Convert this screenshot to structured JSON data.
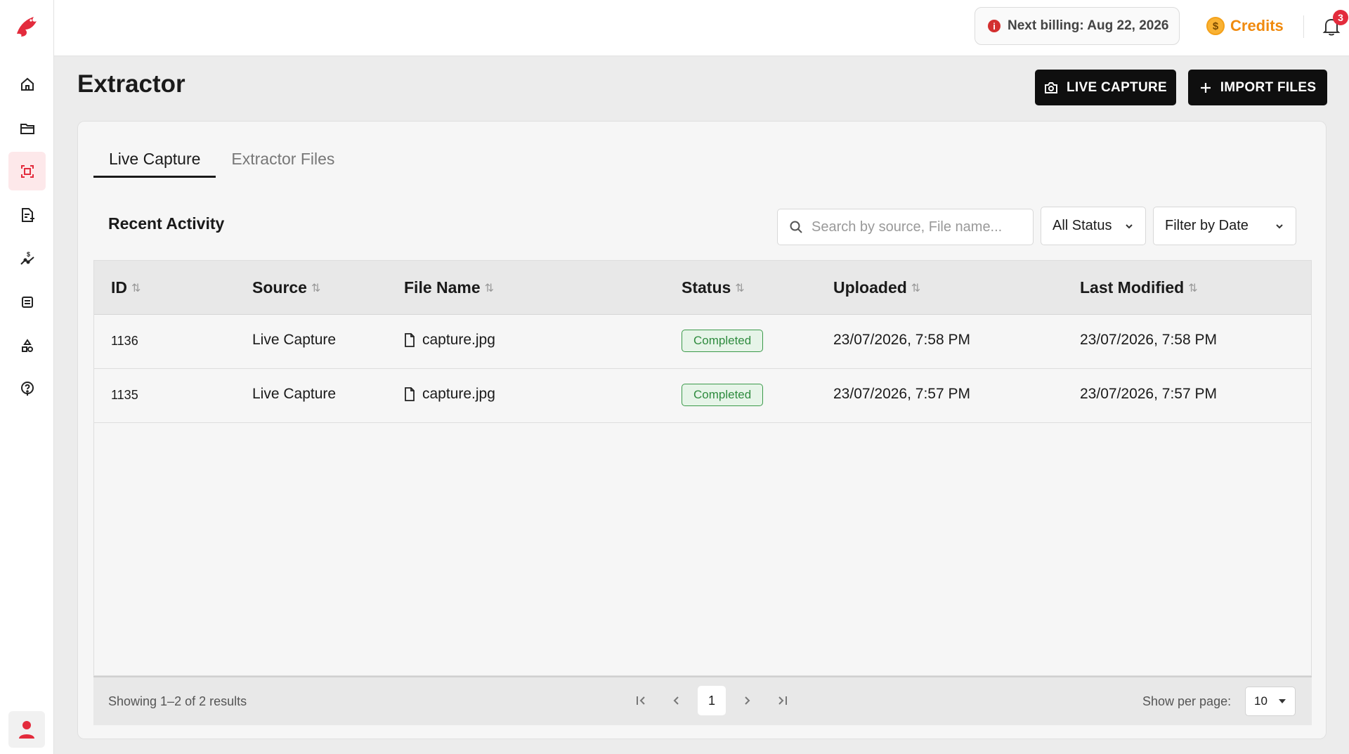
{
  "topbar": {
    "billing_text": "Next billing: Aug 22, 2026",
    "credits_label": "Credits",
    "notification_count": "3"
  },
  "sidebar": {
    "items": [
      {
        "icon": "home-icon"
      },
      {
        "icon": "folder-icon"
      },
      {
        "icon": "scan-icon",
        "active": true
      },
      {
        "icon": "document-add-icon"
      },
      {
        "icon": "pricing-chart-icon"
      },
      {
        "icon": "checklist-icon"
      },
      {
        "icon": "shapes-icon"
      },
      {
        "icon": "help-circle-icon"
      }
    ]
  },
  "header": {
    "title": "Extractor",
    "live_capture_label": "LIVE CAPTURE",
    "import_files_label": "IMPORT FILES"
  },
  "tabs": [
    "Live Capture",
    "Extractor Files"
  ],
  "section": {
    "title": "Recent Activity",
    "search_placeholder": "Search by source, File name...",
    "status_filter": "All Status",
    "date_filter": "Filter by Date"
  },
  "table": {
    "columns": [
      "ID",
      "Source",
      "File Name",
      "Status",
      "Uploaded",
      "Last Modified"
    ],
    "rows": [
      {
        "id": "1136",
        "source": "Live Capture",
        "file": "capture.jpg",
        "status": "Completed",
        "uploaded": "23/07/2026, 7:58 PM",
        "modified": "23/07/2026, 7:58 PM"
      },
      {
        "id": "1135",
        "source": "Live Capture",
        "file": "capture.jpg",
        "status": "Completed",
        "uploaded": "23/07/2026, 7:57 PM",
        "modified": "23/07/2026, 7:57 PM"
      }
    ]
  },
  "footer": {
    "showing": "Showing 1–2 of 2 results",
    "current_page": "1",
    "per_page_label": "Show per page:",
    "per_page_value": "10"
  },
  "colors": {
    "accent": "#e32b3c",
    "credits": "#f08a0e",
    "status_completed": "#2e8b3e"
  }
}
